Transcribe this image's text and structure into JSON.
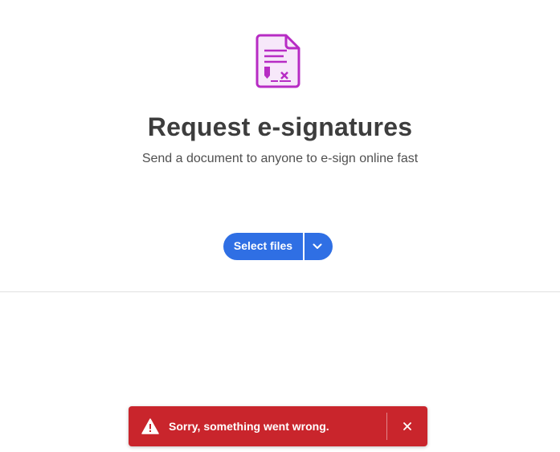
{
  "hero": {
    "icon": "e-sign-document-icon",
    "title": "Request e-signatures",
    "subtitle": "Send a document to anyone to e-sign online fast"
  },
  "actions": {
    "select_files_label": "Select files",
    "dropdown_icon": "chevron-down-icon"
  },
  "toast": {
    "icon": "warning-icon",
    "message": "Sorry, something went wrong.",
    "close_icon": "close-icon"
  },
  "colors": {
    "brand_purple": "#b72cc4",
    "primary_blue": "#2f6fe4",
    "error_red": "#c9252c",
    "title_text": "#3d3d3d"
  }
}
